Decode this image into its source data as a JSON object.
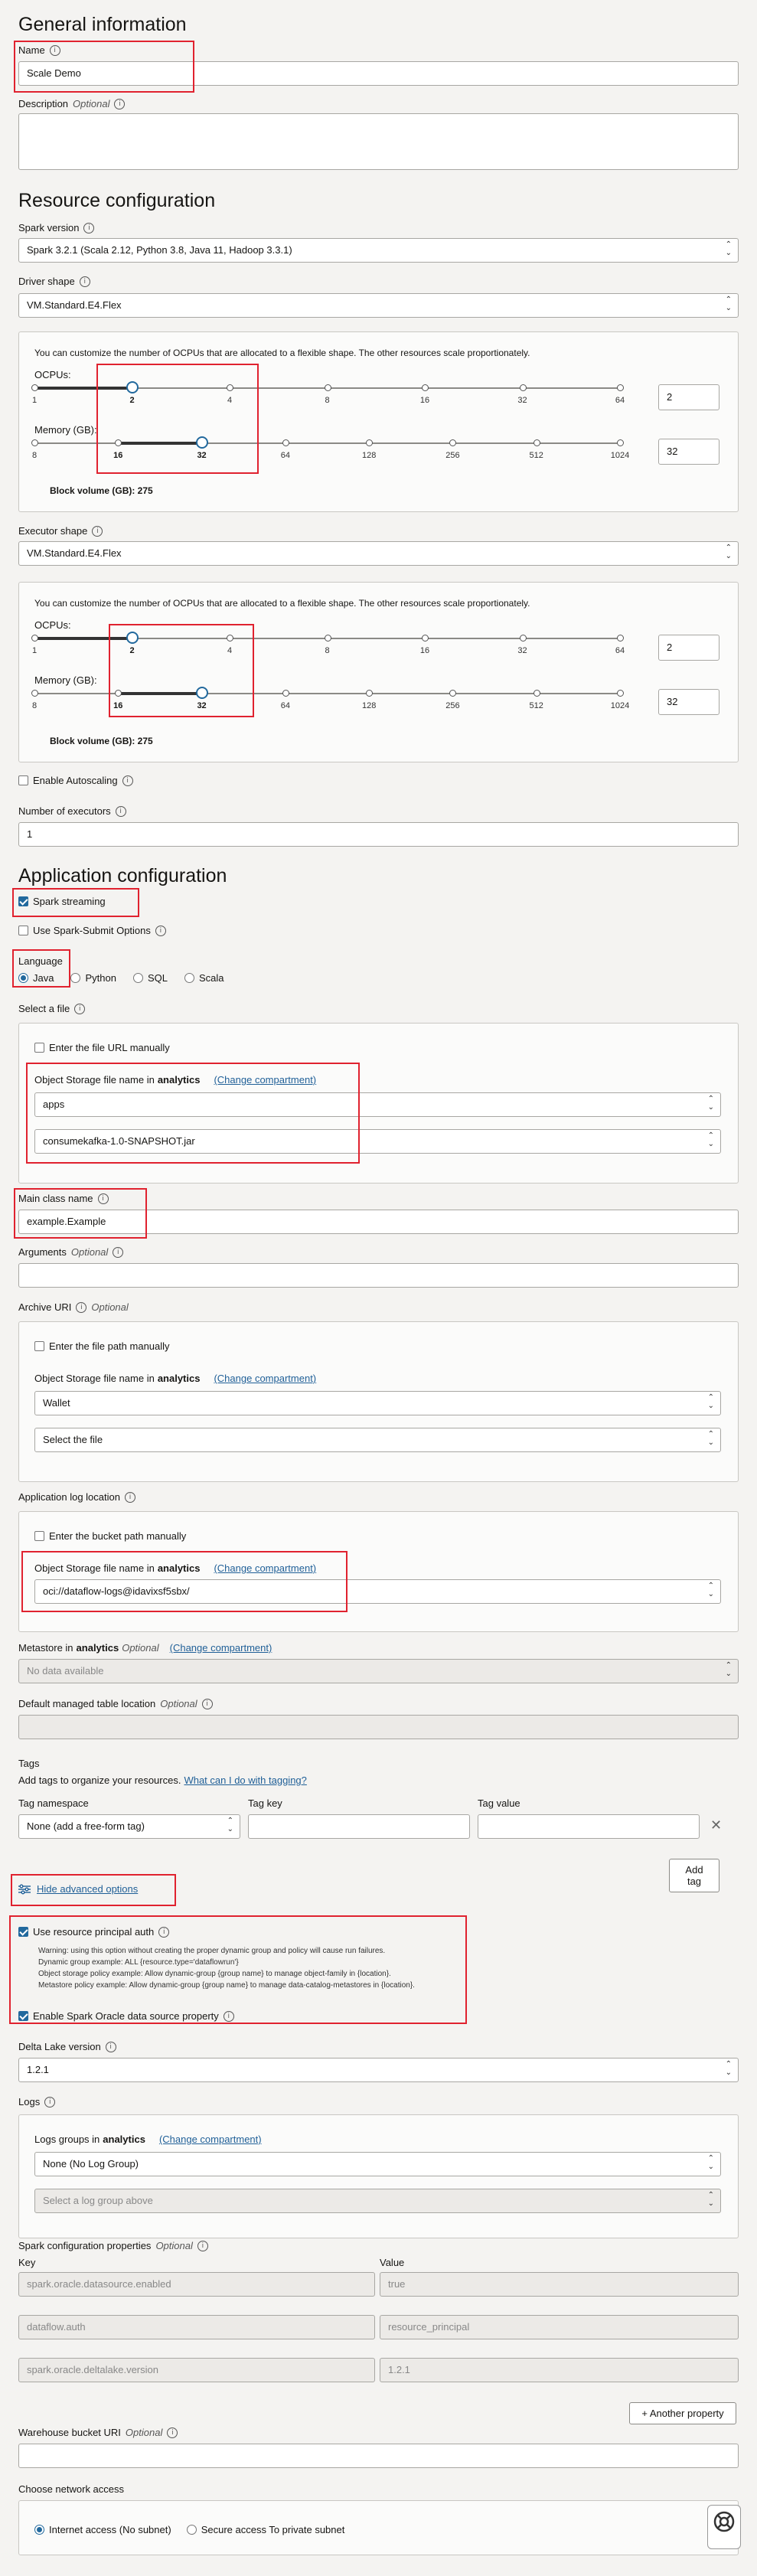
{
  "general": {
    "heading": "General information",
    "name_label": "Name",
    "name_value": "Scale Demo",
    "description_label": "Description",
    "optional": "Optional"
  },
  "resource": {
    "heading": "Resource configuration",
    "spark_version_label": "Spark version",
    "spark_version_value": "Spark 3.2.1 (Scala 2.12, Python 3.8, Java 11, Hadoop 3.3.1)",
    "driver_shape_label": "Driver shape",
    "driver_shape_value": "VM.Standard.E4.Flex",
    "executor_shape_label": "Executor shape",
    "executor_shape_value": "VM.Standard.E4.Flex",
    "flex_note": "You can customize the number of OCPUs that are allocated to a flexible shape. The other resources scale proportionately.",
    "ocpus_label": "OCPUs:",
    "memory_label": "Memory (GB):",
    "ocpu_ticks": [
      "1",
      "2",
      "4",
      "8",
      "16",
      "32",
      "64"
    ],
    "memory_ticks": [
      "8",
      "16",
      "32",
      "64",
      "128",
      "256",
      "512",
      "1024"
    ],
    "driver_ocpus": "2",
    "driver_memory": "32",
    "executor_ocpus": "2",
    "executor_memory": "32",
    "block_volume": "Block volume (GB): 275",
    "enable_autoscaling": "Enable Autoscaling",
    "num_executors_label": "Number of executors",
    "num_executors_value": "1"
  },
  "app": {
    "heading": "Application configuration",
    "spark_streaming": "Spark streaming",
    "use_spark_submit": "Use Spark-Submit Options",
    "language_label": "Language",
    "languages": [
      "Java",
      "Python",
      "SQL",
      "Scala"
    ],
    "select_file_label": "Select a file",
    "enter_url_manually": "Enter the file URL manually",
    "os_file_name_in": "Object Storage file name in",
    "compartment": "analytics",
    "change_compartment": "(Change compartment)",
    "bucket_value": "apps",
    "file_value": "consumekafka-1.0-SNAPSHOT.jar",
    "main_class_label": "Main class name",
    "main_class_value": "example.Example",
    "arguments_label": "Arguments",
    "archive_uri_label": "Archive URI",
    "enter_file_path_manually": "Enter the file path manually",
    "archive_bucket": "Wallet",
    "archive_file": "Select the file",
    "app_log_label": "Application log location",
    "enter_bucket_path_manually": "Enter the bucket path manually",
    "log_bucket": "oci://dataflow-logs@idavixsf5sbx/",
    "metastore_label": "Metastore in",
    "metastore_value": "No data available",
    "default_table_label": "Default managed table location",
    "tags_label": "Tags",
    "tags_help": "Add tags to organize your resources.",
    "tags_link": "What can I do with tagging?",
    "tag_namespace_label": "Tag namespace",
    "tag_namespace_value": "None (add a free-form tag)",
    "tag_key_label": "Tag key",
    "tag_value_label": "Tag value",
    "add_tag": "Add tag",
    "hide_advanced": "Hide advanced options",
    "use_resource_principal": "Use resource principal auth",
    "rp_warning": "Warning: using this option without creating the proper dynamic group and policy will cause run failures.",
    "rp_dyn": "Dynamic group example: ALL {resource.type='dataflowrun'}",
    "rp_os": "Object storage policy example: Allow dynamic-group {group name} to manage object-family in {location}.",
    "rp_meta": "Metastore policy example: Allow dynamic-group {group name} to manage data-catalog-metastores in {location}.",
    "enable_spark_oracle": "Enable Spark Oracle data source property",
    "delta_lake_label": "Delta Lake version",
    "delta_lake_value": "1.2.1",
    "logs_label": "Logs",
    "logs_groups_in": "Logs groups in",
    "log_group_value": "None (No Log Group)",
    "log_select_value": "Select a log group above",
    "spark_conf_label": "Spark configuration properties",
    "key_header": "Key",
    "value_header": "Value",
    "props": [
      {
        "k": "spark.oracle.datasource.enabled",
        "v": "true"
      },
      {
        "k": "dataflow.auth",
        "v": "resource_principal"
      },
      {
        "k": "spark.oracle.deltalake.version",
        "v": "1.2.1"
      }
    ],
    "another_property": "+ Another property",
    "warehouse_label": "Warehouse bucket URI",
    "network_label": "Choose network access",
    "internet_access": "Internet access (No subnet)",
    "secure_access": "Secure access To private subnet"
  },
  "icons": {
    "info": "info-icon",
    "close": "close-icon",
    "sliders": "sliders-icon",
    "help": "help-lifebuoy-icon"
  }
}
